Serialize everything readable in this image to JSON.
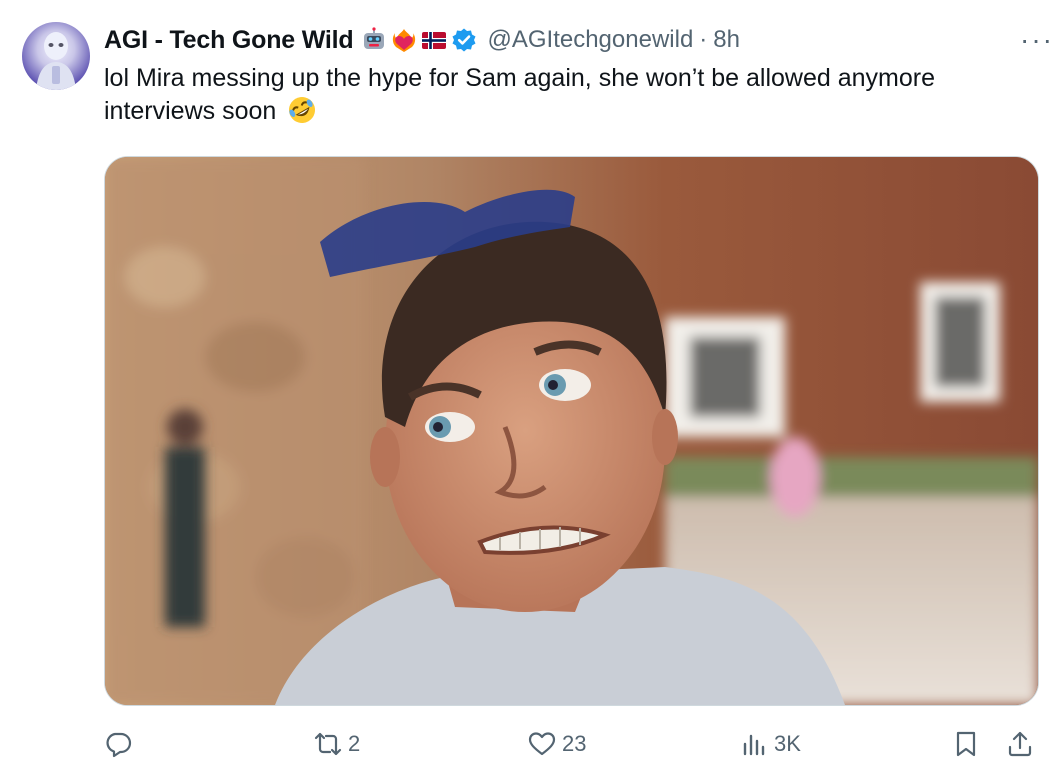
{
  "tweet": {
    "author_name": "AGI - Tech Gone Wild",
    "author_emojis": [
      "robot-face-icon",
      "heart-on-fire-icon",
      "norway-flag-icon"
    ],
    "verified": true,
    "handle": "@AGItechgonewild",
    "separator": "·",
    "time": "8h",
    "more": "···",
    "text": "lol Mira messing up the hype for Sam again, she won’t be allowed anymore interviews soon",
    "text_emoji": "rolling-on-floor-laughing-icon"
  },
  "actions": {
    "reply_count": "",
    "retweet_count": "2",
    "like_count": "23",
    "views_count": "3K"
  },
  "colors": {
    "verified_blue": "#1d9bf0",
    "muted": "#536471",
    "text": "#0f1419"
  }
}
